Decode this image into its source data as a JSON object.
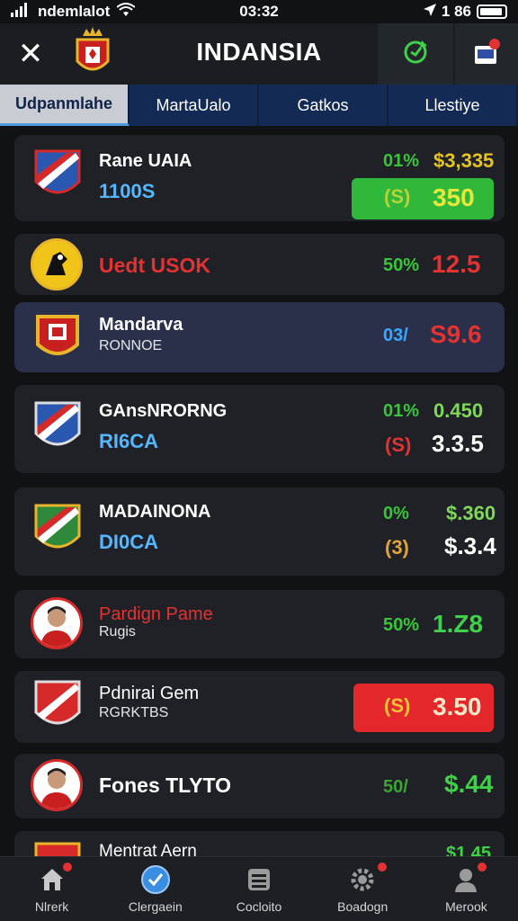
{
  "status": {
    "carrier": "ndemlalot",
    "time": "03:32",
    "right": "1 86"
  },
  "header": {
    "title": "INDANSIA"
  },
  "tabs": [
    {
      "label": "Udpanmlahe",
      "active": true
    },
    {
      "label": "MartaUalo",
      "active": false
    },
    {
      "label": "Gatkos",
      "active": false
    },
    {
      "label": "Llestiye",
      "active": false
    }
  ],
  "rows": [
    {
      "name": "Rane UAIA",
      "sub": "1100S",
      "pct": "01%",
      "price": "$3,335",
      "button_sym": "(S)",
      "button_value": "350"
    },
    {
      "name": "Uedt USOK",
      "pct": "50%",
      "price": "12.5"
    },
    {
      "name": "Mandarva",
      "sub": "RONNOE",
      "pct": "03/",
      "price": "S9.6"
    },
    {
      "name": "GAnsNRORNG",
      "sub": "RI6CA",
      "pct": "01%",
      "price": "0.450",
      "sym": "(S)",
      "value": "3.3.5"
    },
    {
      "name": "MADAINONA",
      "sub": "DI0CA",
      "pct": "0%",
      "price": "$.360",
      "sym": "(3)",
      "value": "$.3.4"
    },
    {
      "name": "Pardign Pame",
      "sub": "Rugis",
      "pct": "50%",
      "price": "1.Z8"
    },
    {
      "name": "Pdnirai Gem",
      "sub": "RGRKTBS",
      "button_sym": "(S)",
      "button_value": "3.50"
    },
    {
      "name": "Fones TLYTO",
      "pct": "50/",
      "price": "$.44"
    },
    {
      "name": "Mentrat Aern",
      "price": "$1.45"
    }
  ],
  "nav": [
    {
      "label": "Nlrerk",
      "icon": "home-icon",
      "dot": true
    },
    {
      "label": "Clergaein",
      "icon": "check-badge-icon",
      "dot": false
    },
    {
      "label": "Cocloito",
      "icon": "list-icon",
      "dot": false
    },
    {
      "label": "Boadogn",
      "icon": "gear-icon",
      "dot": true
    },
    {
      "label": "Merook",
      "icon": "profile-icon",
      "dot": true
    }
  ],
  "colors": {
    "background": "#111214",
    "tab_bar": "#132a55",
    "accent_green": "#39c43a",
    "accent_red": "#e23232",
    "accent_yellow": "#e6c323",
    "accent_blue": "#56b7ff"
  }
}
